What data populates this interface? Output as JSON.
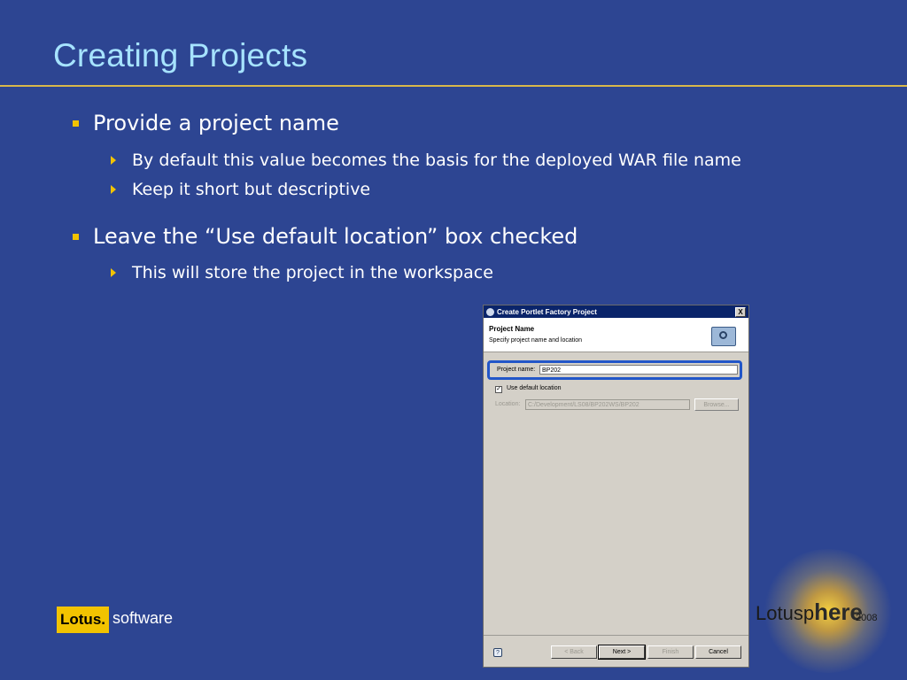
{
  "slide": {
    "title": "Creating Projects",
    "bullets": [
      {
        "text": "Provide a project name",
        "sub": [
          "By default this value becomes the basis for the deployed WAR file name",
          "Keep it short but descriptive"
        ]
      },
      {
        "text": "Leave the “Use default location” box checked",
        "sub": [
          "This will store the project in the workspace"
        ]
      }
    ]
  },
  "dialog": {
    "title": "Create Portlet Factory Project",
    "header_title": "Project Name",
    "header_subtitle": "Specify project name and location",
    "project_name_label": "Project name:",
    "project_name_value": "BP202",
    "use_default_label": "Use default location",
    "use_default_checked": true,
    "location_label": "Location:",
    "location_value": "C:/Development/LS08/BP202WS/BP202",
    "browse_label": "Browse...",
    "help_label": "?",
    "back_label": "< Back",
    "next_label": "Next >",
    "finish_label": "Finish",
    "cancel_label": "Cancel",
    "close_label": "X"
  },
  "branding": {
    "lotus_word": "Lotus.",
    "software_word": "software",
    "lotusphere_prefix": "Lotusp",
    "lotusphere_here": "here",
    "lotusphere_year": "2008"
  },
  "colors": {
    "background": "#2d4592",
    "title": "#a6e3ff",
    "accent": "#f2c300",
    "highlight_ring": "#2256c8"
  },
  "icons": [
    "bullet-square-icon",
    "bullet-arrow-icon",
    "eclipse-app-icon",
    "close-icon",
    "wizard-banner-icon",
    "checkbox-checked-icon",
    "help-icon"
  ]
}
